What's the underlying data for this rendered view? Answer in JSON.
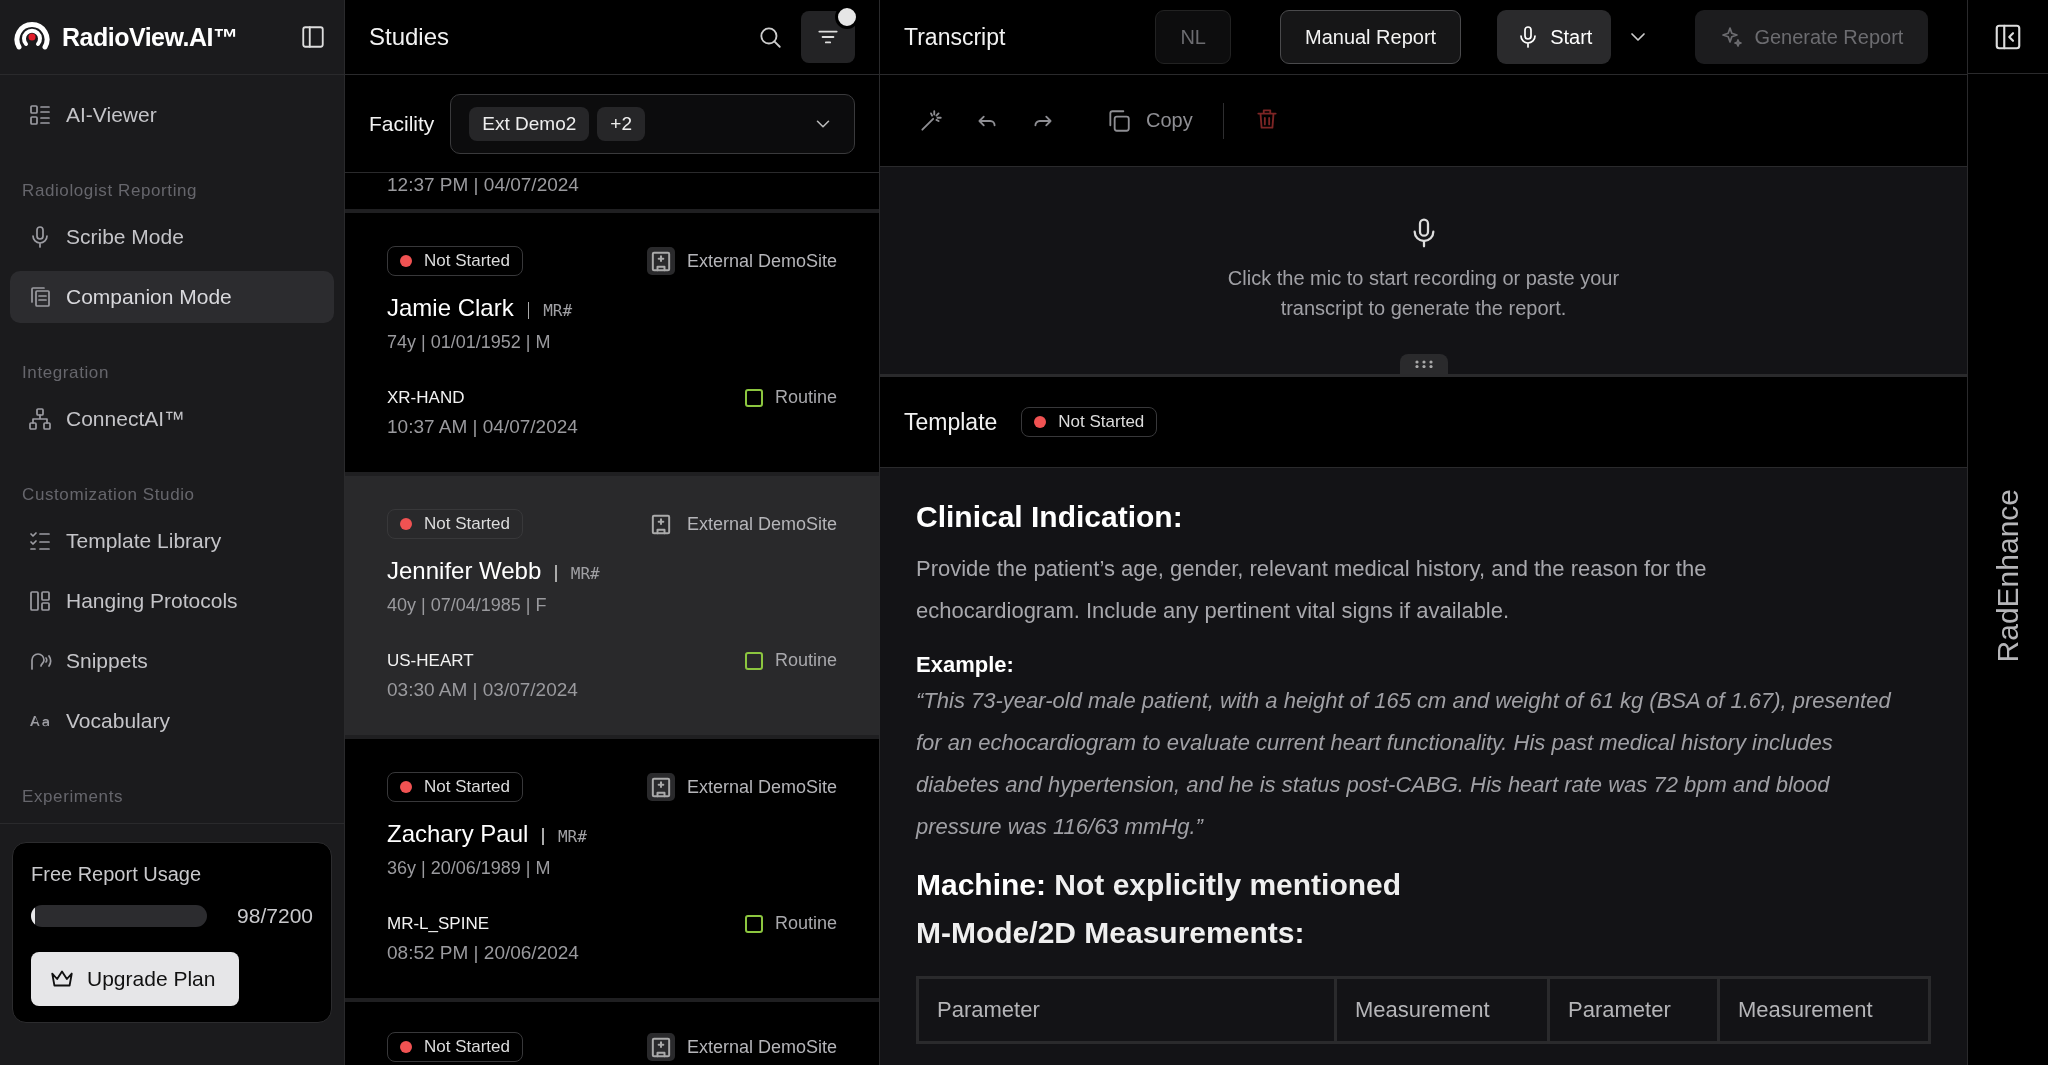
{
  "sidebar": {
    "brand": "RadioView.AI™",
    "sections": [
      {
        "items": [
          {
            "label": "AI-Viewer",
            "selected": false
          }
        ]
      },
      {
        "heading": "Radiologist Reporting",
        "items": [
          {
            "label": "Scribe Mode",
            "selected": false
          },
          {
            "label": "Companion Mode",
            "selected": true
          }
        ]
      },
      {
        "heading": "Integration",
        "items": [
          {
            "label": "ConnectAI™",
            "selected": false
          }
        ]
      },
      {
        "heading": "Customization Studio",
        "items": [
          {
            "label": "Template Library",
            "selected": false
          },
          {
            "label": "Hanging Protocols",
            "selected": false
          },
          {
            "label": "Snippets",
            "selected": false
          },
          {
            "label": "Vocabulary",
            "selected": false
          }
        ]
      },
      {
        "heading": "Experiments"
      }
    ],
    "usage": {
      "title": "Free Report Usage",
      "level": 0.02,
      "reading": "98/7200",
      "button": "Upgrade Plan"
    }
  },
  "studies": {
    "title": "Studies",
    "filters_applied": true,
    "facility": {
      "label": "Facility",
      "chips": [
        "Ext Demo2",
        "+2"
      ]
    },
    "above": {
      "time": "12:37 PM | 04/07/2024"
    },
    "cards": [
      {
        "status": {
          "text": "Not Started",
          "color": "#f05252"
        },
        "site": "External DemoSite",
        "name": "Jamie Clark",
        "mr": "MR#",
        "demographics": "74y | 01/01/1952 | M",
        "study": "XR-HAND",
        "time": "10:37 AM | 04/07/2024",
        "priority": "Routine",
        "selected": false
      },
      {
        "status": {
          "text": "Not Started",
          "color": "#f05252"
        },
        "site": "External DemoSite",
        "name": "Jennifer Webb",
        "mr": "MR#",
        "demographics": "40y | 07/04/1985 | F",
        "study": "US-HEART",
        "time": "03:30 AM | 03/07/2024",
        "priority": "Routine",
        "selected": true
      },
      {
        "status": {
          "text": "Not Started",
          "color": "#f05252"
        },
        "site": "External DemoSite",
        "name": "Zachary Paul",
        "mr": "MR#",
        "demographics": "36y | 20/06/1989 | M",
        "study": "MR-L_SPINE",
        "time": "08:52 PM | 20/06/2024",
        "priority": "Routine",
        "selected": false
      }
    ],
    "below": {
      "status": {
        "text": "Not Started",
        "color": "#f05252"
      },
      "site": "External DemoSite"
    }
  },
  "transcript": {
    "title": "Transcript",
    "actions": [
      {
        "label": "NL",
        "kind": "plain",
        "disabled": true
      },
      {
        "label": "Manual Report",
        "kind": "outline",
        "disabled": false
      },
      {
        "label": "Start",
        "kind": "record",
        "disabled": false
      },
      {
        "kind": "dropdown",
        "disabled": false
      },
      {
        "label": "Generate Report",
        "kind": "generate",
        "disabled": true
      }
    ],
    "copy": "Copy",
    "hint": "Click the mic to start recording or paste your transcript to generate the report."
  },
  "template": {
    "title": "Template",
    "status": {
      "text": "Not Started",
      "color": "#f05252"
    },
    "blocks": [
      {
        "kind": "heading",
        "text": "Clinical Indication:"
      },
      {
        "kind": "paragraph",
        "text": "Provide the patient’s age, gender, relevant medical history, and the reason for the echocardiogram. Include any pertinent vital signs if available."
      },
      {
        "kind": "label",
        "text": "Example:"
      },
      {
        "kind": "quote",
        "text": "“This 73-year-old male patient, with a height of 165 cm and weight of 61 kg (BSA of 1.67), presented for an echocardiogram to evaluate current heart functionality. His past medical history includes diabetes and hypertension, and he is status post-CABG. His heart rate was 72 bpm and blood pressure was 116/63 mmHg.”"
      },
      {
        "kind": "heading",
        "text": "**Machine:** Not explicitly mentioned"
      },
      {
        "kind": "heading",
        "text": "M-Mode/2D Measurements:"
      },
      {
        "kind": "table",
        "columns": [
          "Parameter",
          "Measurement",
          "Parameter",
          "Measurement"
        ]
      }
    ]
  },
  "rail": {
    "title": "RadEnhance"
  }
}
